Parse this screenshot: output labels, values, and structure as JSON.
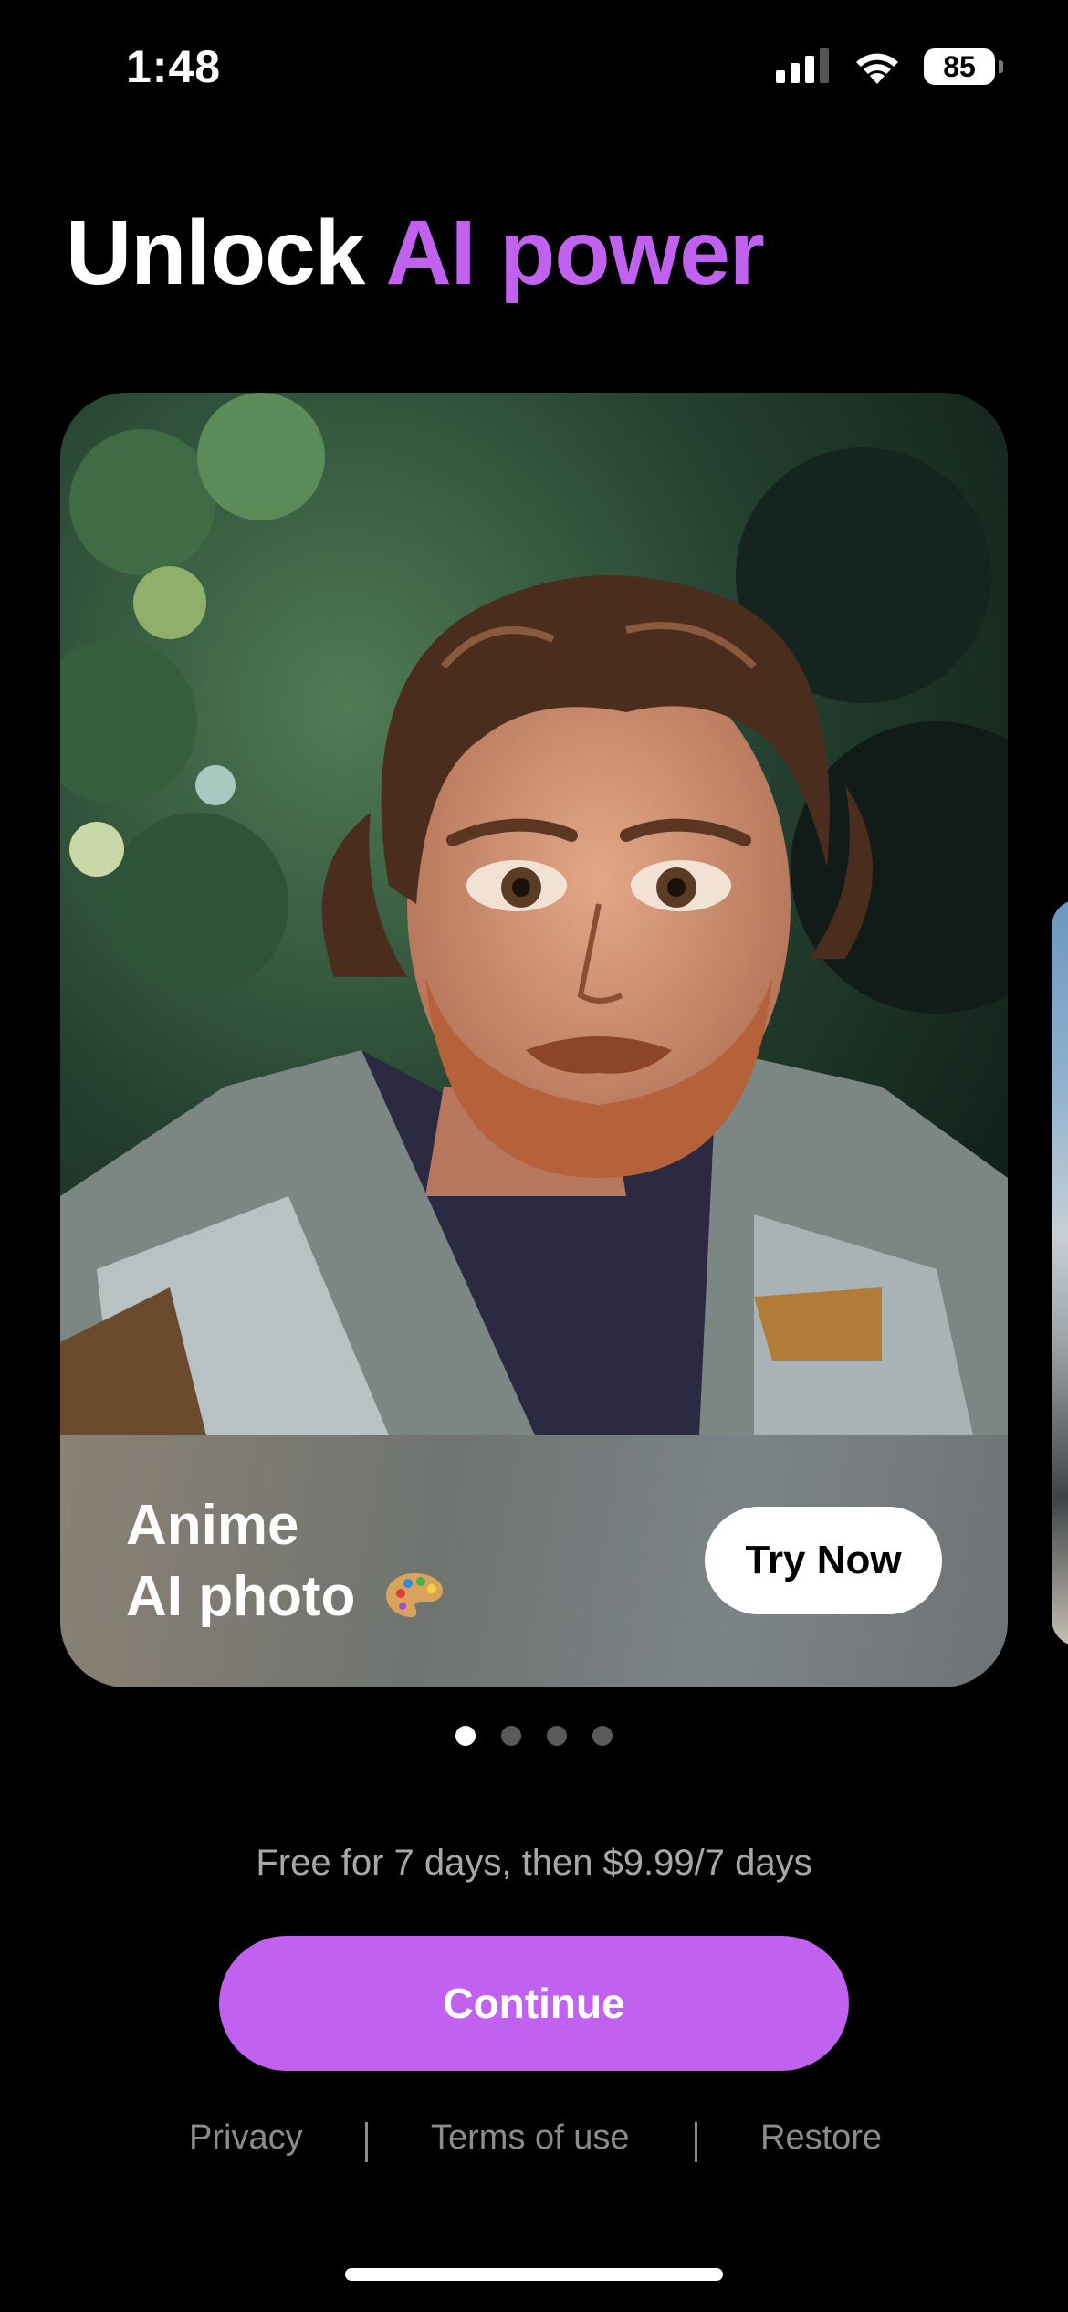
{
  "status_bar": {
    "time": "1:48",
    "battery": "85",
    "signal_icon": "cellular-signal-icon",
    "wifi_icon": "wifi-icon"
  },
  "header": {
    "title_plain": "Unlock ",
    "title_accent": "AI power",
    "accent_color": "#c061f0"
  },
  "carousel": {
    "card": {
      "title_line1": "Anime",
      "title_line2": "AI photo",
      "emoji_icon": "artist-palette-icon",
      "button_label": "Try Now"
    },
    "pages_total": 4,
    "active_page": 1
  },
  "pricing": {
    "text": "Free for 7 days, then $9.99/7 days"
  },
  "cta": {
    "label": "Continue",
    "color": "#c061f0"
  },
  "footer": {
    "privacy": "Privacy",
    "terms": "Terms of use",
    "restore": "Restore"
  }
}
